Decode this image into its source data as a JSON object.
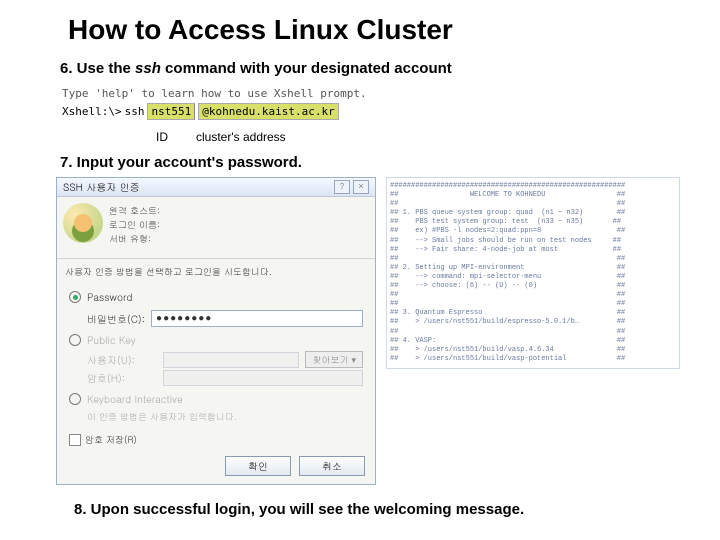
{
  "title": "How to Access Linux Cluster",
  "step6_prefix": "6. Use the ",
  "step6_cmd": "ssh",
  "step6_suffix": " command with your designated account",
  "term_line1": "Type 'help' to learn how to use Xshell prompt.",
  "term_prompt": "Xshell:\\>",
  "term_ssh": "ssh",
  "ssh_id": "nst551",
  "ssh_at": "@",
  "ssh_addr": "kohnedu.kaist.ac.kr",
  "annot_id": "ID",
  "annot_addr": "cluster's address",
  "step7": "7. Input your account's password.",
  "dialog": {
    "title": "SSH 사용자 인증",
    "fields": {
      "remote_host_label": "원격 호스트:",
      "remote_host_value": "",
      "login_name_label": "로그인 이름:",
      "login_name_value": "",
      "server_type_label": "서버 유형:",
      "server_type_value": ""
    },
    "msg": "사용자 인증 방법을 선택하고 로그인을 시도합니다.",
    "radio_password": "Password",
    "pwd_label": "비밀번호(C):",
    "pwd_value": "●●●●●●●●",
    "radio_pubkey": "Public Key",
    "pk_user_label": "사용자(U):",
    "pk_pass_label": "암호(H):",
    "browse": "찾아보기 ▾",
    "radio_kb": "Keyboard Interactive",
    "kb_msg": "이 인증 방법은 사용자가 입력합니다.",
    "remember": "암호 저장(R)",
    "ok": "확인",
    "cancel": "취소"
  },
  "motd": "########################################################\n##                 WELCOME TO KOHNEDU                 ##\n##                                                    ##\n## 1. PBS queue system group: quad  (n1 ~ n32)        ##\n##    PBS test system group: test  (n33 ~ n35)       ##\n##    ex) #PBS -l nodes=2:quad:ppn=8                  ##\n##    --> Small jobs should be run on test nodes     ##\n##    --> Fair share: 4-node-job at most             ##\n##                                                    ##\n## 2. Setting up MPI-environment                      ##\n##    --> command: mpi-selector-menu                  ##\n##    --> choose: (6) -- (U) -- (0)                   ##\n##                                                    ##\n##                                                    ##\n## 3. Quantum Espresso                                ##\n##    > /users/nst551/build/espresso-5.0.1/b…         ##\n##                                                    ##\n## 4. VASP:                                           ##\n##    > /users/nst551/build/vasp.4.6.34               ##\n##    > /users/nst551/build/vasp-potential            ##",
  "step8": "8. Upon successful login, you will see the welcoming message."
}
